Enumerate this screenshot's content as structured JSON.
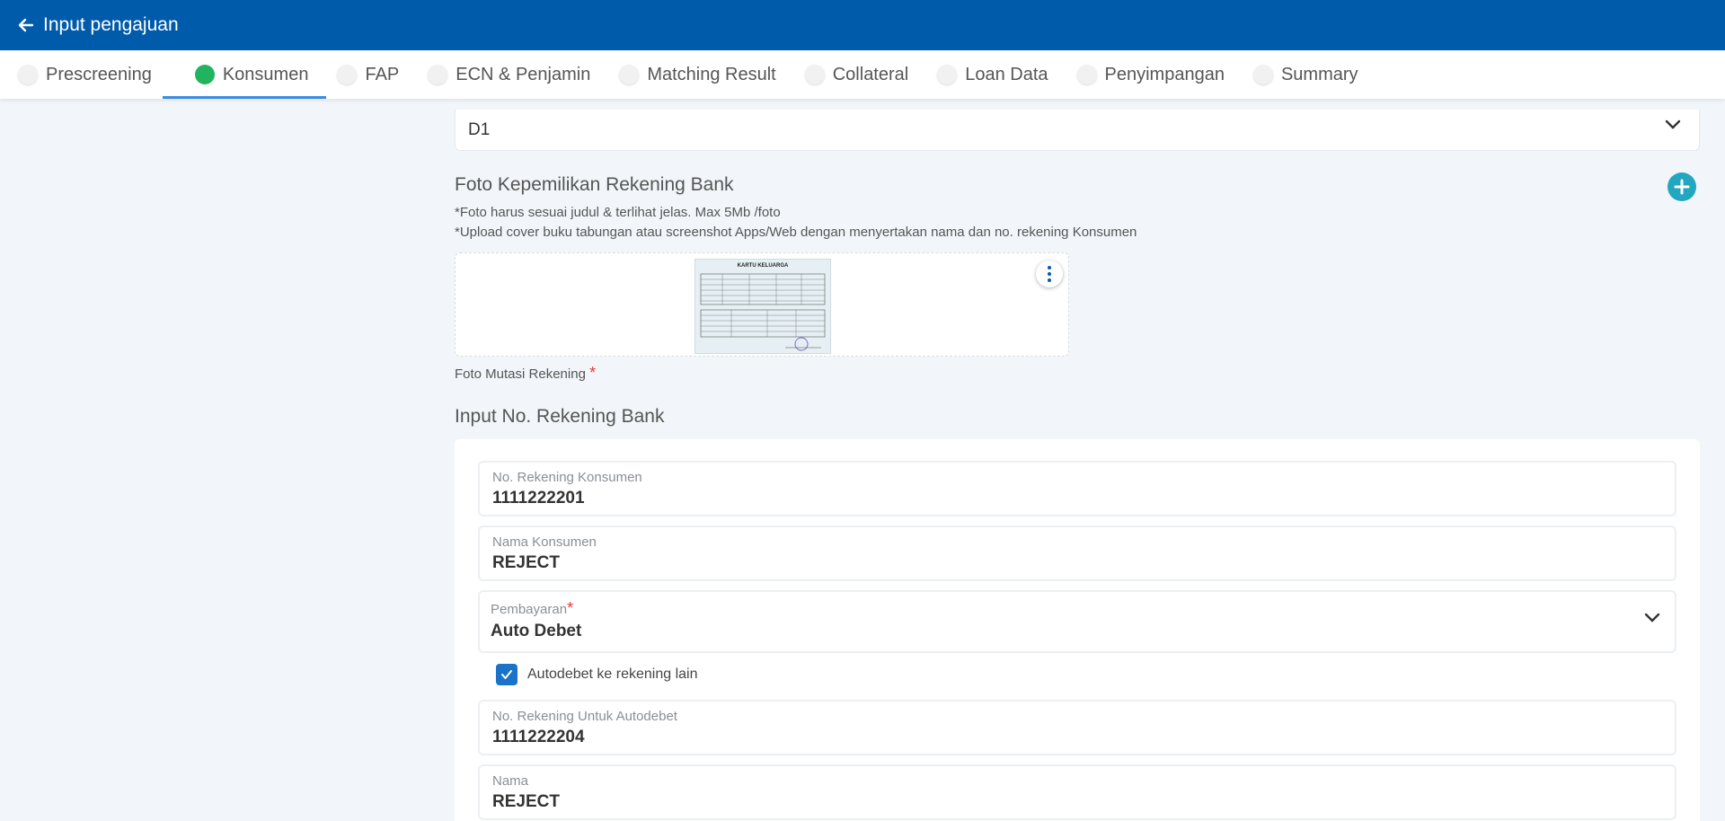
{
  "header": {
    "title": "Input pengajuan"
  },
  "tabs": [
    {
      "label": "Prescreening",
      "active": false
    },
    {
      "label": "Konsumen",
      "active": true
    },
    {
      "label": "FAP",
      "active": false
    },
    {
      "label": "ECN & Penjamin",
      "active": false
    },
    {
      "label": "Matching Result",
      "active": false
    },
    {
      "label": "Collateral",
      "active": false
    },
    {
      "label": "Loan Data",
      "active": false
    },
    {
      "label": "Penyimpangan",
      "active": false
    },
    {
      "label": "Summary",
      "active": false
    }
  ],
  "top_select": {
    "value": "D1"
  },
  "photo_section": {
    "title": "Foto Kepemilikan Rekening Bank",
    "note1": "*Foto harus sesuai judul & terlihat jelas. Max 5Mb /foto",
    "note2": "*Upload cover buku tabungan atau screenshot Apps/Web dengan menyertakan nama dan no. rekening Konsumen",
    "thumbnail_heading": "KARTU KELUARGA",
    "photo_label": "Foto Mutasi Rekening",
    "required_mark": "*"
  },
  "bank_section": {
    "title": "Input No. Rekening Bank",
    "fields": {
      "rekening_konsumen": {
        "label": "No. Rekening Konsumen",
        "value": "1111222201"
      },
      "nama_konsumen": {
        "label": "Nama Konsumen",
        "value": "REJECT"
      },
      "pembayaran": {
        "label": "Pembayaran",
        "required": "*",
        "value": "Auto Debet"
      },
      "autodebet_checkbox": {
        "label": "Autodebet ke rekening lain",
        "checked": true
      },
      "rekening_autodebet": {
        "label": "No. Rekening Untuk Autodebet",
        "value": "1111222204"
      },
      "nama": {
        "label": "Nama",
        "value": "REJECT"
      }
    }
  },
  "colors": {
    "primary": "#005bab",
    "active_dot": "#22b35e",
    "accent": "#22a7c0",
    "required": "#e53935"
  }
}
